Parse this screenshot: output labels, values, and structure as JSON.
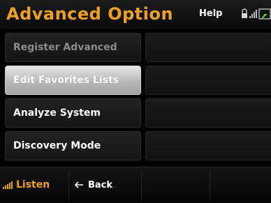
{
  "header": {
    "title": "Advanced Option",
    "help_label": "Help",
    "status_icons": [
      "lock-icon",
      "signal-strength-icon",
      "battery-icon"
    ]
  },
  "menu": {
    "items": [
      {
        "label": "Register Advanced",
        "state": "disabled"
      },
      {
        "label": "Edit Favorites Lists",
        "state": "selected"
      },
      {
        "label": "Analyze System",
        "state": "normal"
      },
      {
        "label": "Discovery Mode",
        "state": "normal"
      }
    ]
  },
  "bottom_bar": {
    "listen_label": "Listen",
    "back_label": "Back",
    "signal_icon": "signal-bars-icon",
    "back_icon": "left-arrow-icon"
  },
  "colors": {
    "accent": "#f0a020",
    "background": "#000000",
    "selected_button": "#c4c4c4",
    "disabled_text": "#8c8c8c"
  }
}
